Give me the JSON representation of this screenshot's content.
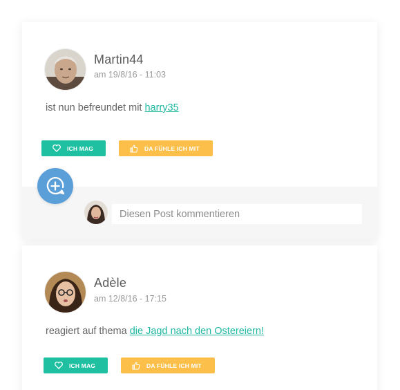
{
  "posts": [
    {
      "author": "Martin44",
      "timestamp": "am 19/8/16 - 11:03",
      "text_prefix": "ist nun befreundet mit ",
      "link": "harry35",
      "like_label": "ICH MAG",
      "feel_label": "DA FÜHLE ICH MIT"
    },
    {
      "author": "Adèle",
      "timestamp": "am 12/8/16 - 17:15",
      "text_prefix": "reagiert auf thema ",
      "link": "die Jagd nach den Ostereiern!",
      "like_label": "ICH MAG",
      "feel_label": "DA FÜHLE ICH MIT"
    }
  ],
  "comment": {
    "placeholder": "Diesen Post kommentieren"
  },
  "colors": {
    "like": "#1fbfa2",
    "feel": "#fbbf4a",
    "link": "#1fb8a1",
    "fab": "#5b9fd9"
  },
  "icons": {
    "like": "heart-icon",
    "feel": "thumbs-up-icon",
    "fab": "add-comment-icon"
  }
}
